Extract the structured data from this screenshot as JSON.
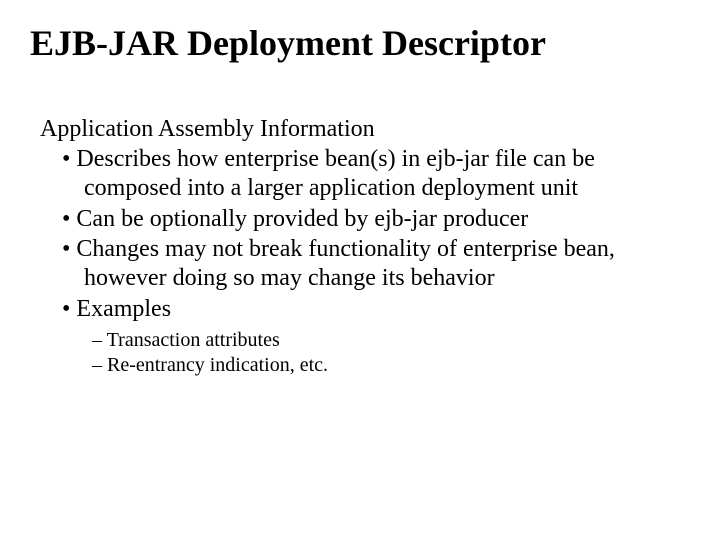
{
  "title": "EJB-JAR Deployment Descriptor",
  "subtitle": "Application Assembly Information",
  "bullets": [
    "Describes how enterprise bean(s) in ejb-jar file can be composed into a larger application deployment unit",
    "Can be optionally provided by ejb-jar producer",
    "Changes may not break functionality of enterprise bean, however doing so may change its behavior",
    "Examples"
  ],
  "sub_bullets": [
    "Transaction attributes",
    "Re-entrancy indication, etc."
  ]
}
